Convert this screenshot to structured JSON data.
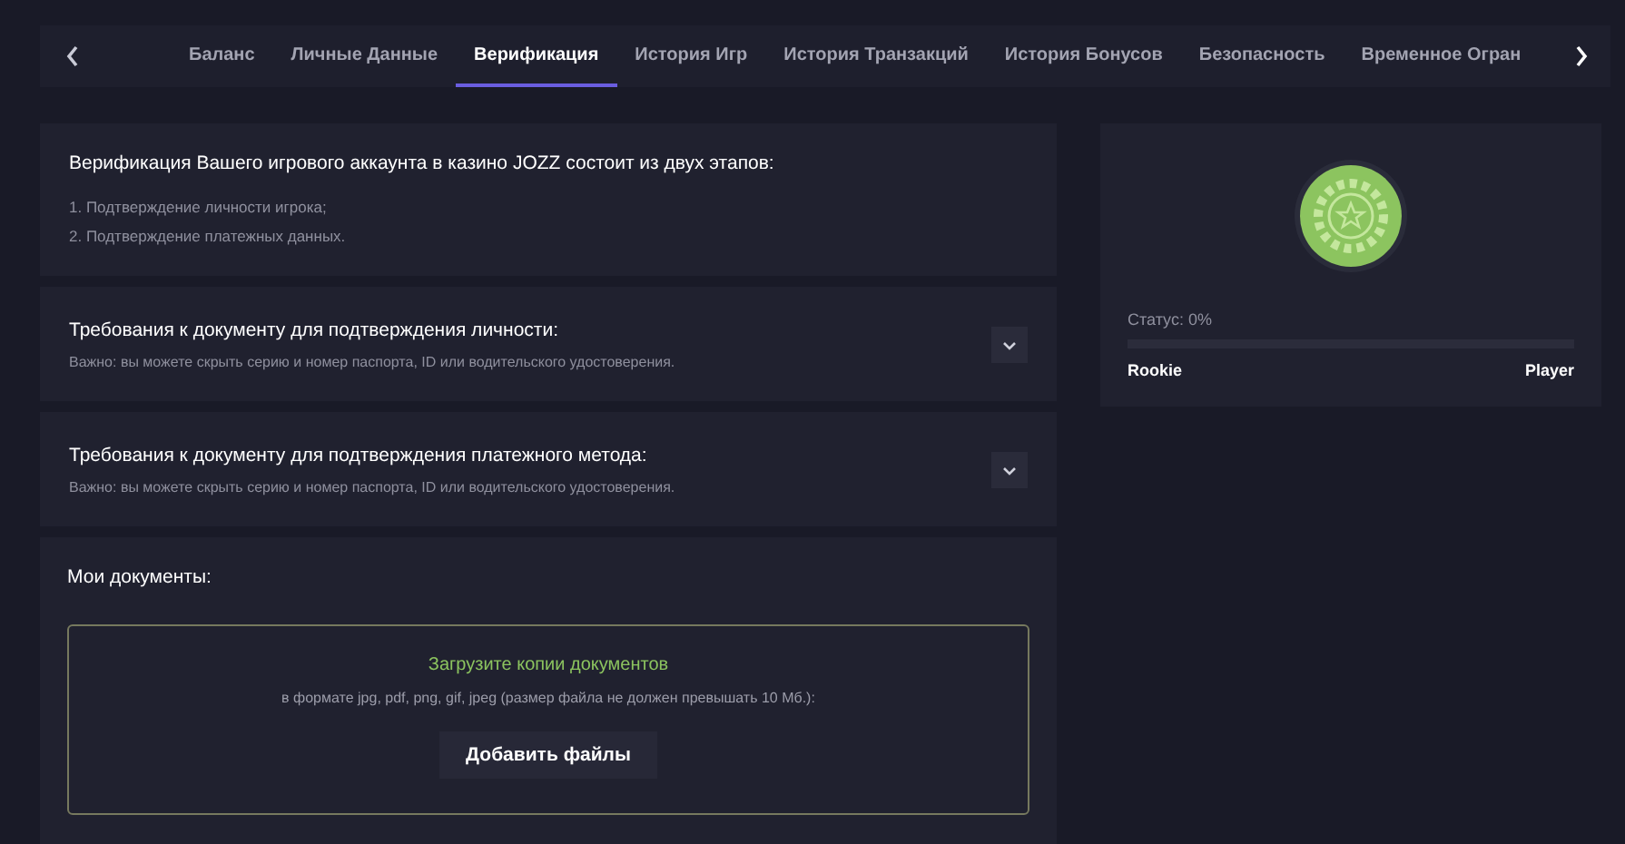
{
  "tabs": [
    {
      "label": "Баланс",
      "selected": false
    },
    {
      "label": "Личные Данные",
      "selected": false
    },
    {
      "label": "Верификация",
      "selected": true
    },
    {
      "label": "История Игр",
      "selected": false
    },
    {
      "label": "История Транзакций",
      "selected": false
    },
    {
      "label": "История Бонусов",
      "selected": false
    },
    {
      "label": "Безопасность",
      "selected": false
    },
    {
      "label": "Временное Огран",
      "selected": false
    }
  ],
  "intro": {
    "title": "Верификация Вашего игрового аккаунта в казино JOZZ состоит из двух этапов:",
    "steps": [
      "1. Подтверждение личности игрока;",
      "2. Подтверждение платежных данных."
    ]
  },
  "requirements": [
    {
      "title": "Требования к документу для подтверждения личности:",
      "note": "Важно: вы можете скрыть серию и номер паспорта, ID или водительского удостоверения.",
      "expanded": false
    },
    {
      "title": "Требования к документу для подтверждения платежного метода:",
      "note": "Важно: вы можете скрыть серию и номер паспорта, ID или водительского удостоверения.",
      "expanded": false
    }
  ],
  "documents": {
    "title": "Мои документы:",
    "upload_title": "Загрузите копии документов",
    "upload_hint": "в формате jpg, pdf, png, gif, jpeg (размер файла не должен превышать 10 Мб.):",
    "button": "Добавить файлы"
  },
  "status": {
    "label": "Статус: 0%",
    "level": 0,
    "from": "Rookie",
    "to": "Player"
  }
}
